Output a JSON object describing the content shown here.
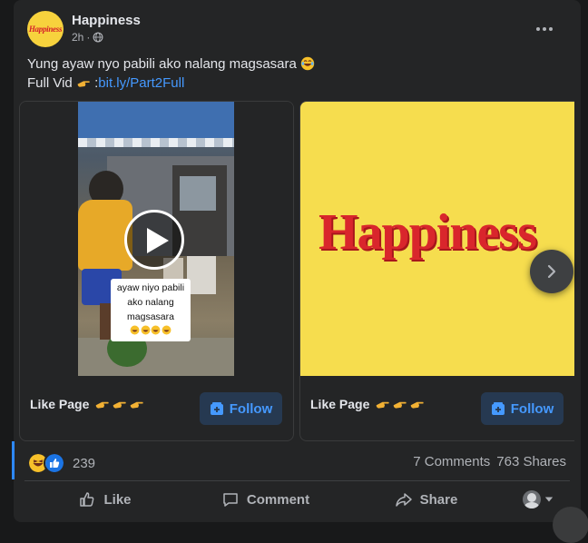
{
  "post": {
    "page_name": "Happiness",
    "avatar_text": "Happiness",
    "time": "2h",
    "privacy_icon": "globe-icon",
    "text_line1": "Yung ayaw nyo pabili ako nalang magsasara",
    "text_line2_prefix": "Full Vid",
    "text_line2_sep": ":",
    "link": "bit.ly/Part2Full"
  },
  "carousel": {
    "cards": [
      {
        "type": "video",
        "caption_lines": [
          "ayaw niyo pabili",
          "ako nalang",
          "magsasara"
        ],
        "like_label": "Like Page",
        "follow_label": "Follow"
      },
      {
        "type": "image",
        "brand_text": "Happiness",
        "like_label": "Like Page",
        "follow_label": "Follow"
      }
    ],
    "next_icon": "chevron-right-icon"
  },
  "stats": {
    "reaction_count": "239",
    "comments": "7 Comments",
    "shares": "763 Shares"
  },
  "actions": {
    "like": "Like",
    "comment": "Comment",
    "share": "Share"
  },
  "colors": {
    "accent": "#2d88ff",
    "link": "#4599ff",
    "brand_yellow": "#f6dd4e",
    "brand_red": "#d9262c"
  }
}
